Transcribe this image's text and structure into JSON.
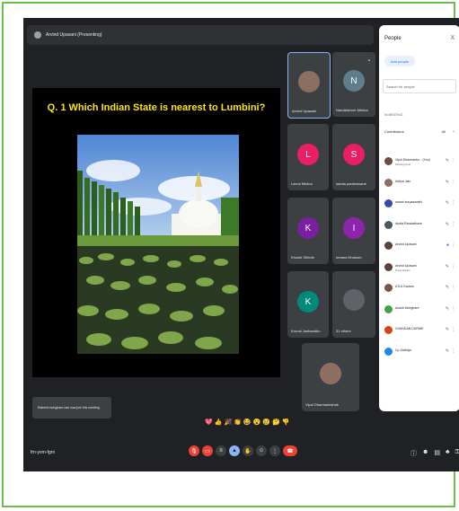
{
  "meeting": {
    "presenter_label": "Arvind Upasani (Presenting)",
    "meeting_code": "frn-yvrn-fgrn"
  },
  "slide": {
    "question": "Q. 1 Which Indian State is nearest to Lumbini?"
  },
  "tiles": [
    {
      "name": "Arvind Upasani",
      "initial": "",
      "color": "#8d6e63"
    },
    {
      "name": "Nandkishore Mishra",
      "initial": "N",
      "color": "#607d8b"
    },
    {
      "name": "Laxmi Mishra",
      "initial": "L",
      "color": "#e91e63"
    },
    {
      "name": "sarala pardeswane",
      "initial": "S",
      "color": "#e91e63"
    },
    {
      "name": "Khushi Shinde",
      "initial": "K",
      "color": "#7b1fa2"
    },
    {
      "name": "Imrana Khatoon",
      "initial": "I",
      "color": "#8e24aa"
    },
    {
      "name": "Krunal Janbandhu",
      "initial": "K",
      "color": "#00897b"
    },
    {
      "name": "31 others",
      "initial": "",
      "color": "#5f6368"
    },
    {
      "name": "Vipul Dharmankshak",
      "initial": "",
      "color": "#8d6e63"
    }
  ],
  "people_panel": {
    "title": "People",
    "close_icon": "X",
    "add_people": "Add people",
    "search_placeholder": "Search for people",
    "section_label": "IN MEETING",
    "contributors_label": "Contributors",
    "contributors_count": "40",
    "participants": [
      {
        "name": "Vipul Dharmanks... (You)",
        "sub": "Meeting host",
        "color": "#6d4c41"
      },
      {
        "name": "Aditya Jain",
        "sub": "",
        "color": "#8d6e63"
      },
      {
        "name": "anand suryawanshi",
        "sub": "",
        "color": "#3949ab"
      },
      {
        "name": "Arpita Randadhave",
        "sub": "",
        "color": "#455a64"
      },
      {
        "name": "Arvind Upasani",
        "sub": "",
        "color": "#5d4037"
      },
      {
        "name": "Arvind Upasani",
        "sub": "Presentation",
        "color": "#5d4037"
      },
      {
        "name": "ATUL Kadam",
        "sub": "",
        "color": "#795548"
      },
      {
        "name": "Avanti Mohghare",
        "sub": "",
        "color": "#43a047"
      },
      {
        "name": "CHANDAN DURWE",
        "sub": "",
        "color": "#d84315"
      },
      {
        "name": "Cp Sabhiye",
        "sub": "",
        "color": "#1e88e5"
      }
    ]
  },
  "toast": "Rakshit mohghare can now join this meeting",
  "reactions": [
    "💖",
    "👍",
    "🎉",
    "👏",
    "😂",
    "😮",
    "😢",
    "🤔",
    "👎"
  ]
}
